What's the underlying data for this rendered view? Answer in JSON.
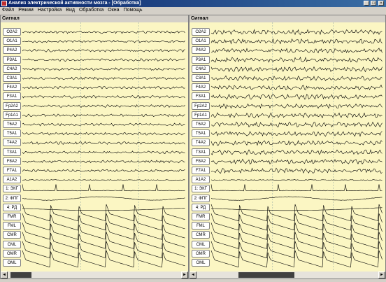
{
  "window": {
    "title": "Анализ электрической активности мозга - [Обработка]",
    "min_label": "_",
    "max_label": "□",
    "close_label": "×"
  },
  "menu": [
    "Файл",
    "Режим",
    "Настройка",
    "Вид",
    "Обработка",
    "Окна",
    "Помощь"
  ],
  "left_panel": {
    "title": "Сигнал"
  },
  "right_panel": {
    "title": "Сигнал"
  },
  "channels": [
    "O2A2",
    "O1A1",
    "P4A2",
    "P3A1",
    "C4A2",
    "C3A1",
    "F4A2",
    "F3A1",
    "Fp2A2",
    "Fp1A1",
    "T6A2",
    "T5A1",
    "T4A2",
    "T3A1",
    "F8A2",
    "F7A1",
    "A1A2",
    "1: ЭКГ",
    "2: ФПГ",
    "4: РД",
    "FMR",
    "FML",
    "CMR",
    "CML",
    "OMR",
    "OML"
  ],
  "scrollbar": {
    "left_arrow": "◄",
    "right_arrow": "►"
  },
  "colors": {
    "background": "#fbf6c3",
    "trace": "#000000",
    "divider": "#88a0a0"
  }
}
